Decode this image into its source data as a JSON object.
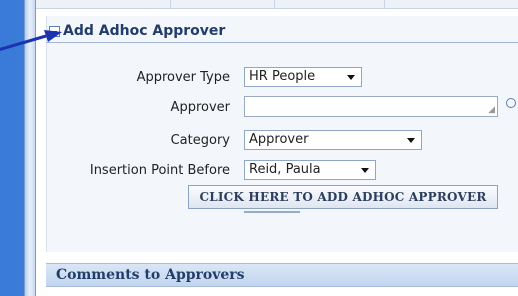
{
  "section": {
    "title": "Add Adhoc Approver"
  },
  "form": {
    "approver_type": {
      "label": "Approver Type",
      "value": "HR People"
    },
    "approver": {
      "label": "Approver",
      "value": ""
    },
    "category": {
      "label": "Category",
      "value": "Approver"
    },
    "insertion_point": {
      "label": "Insertion Point Before",
      "value": "Reid, Paula"
    },
    "add_button_label": "CLICK HERE TO ADD ADHOC APPROVER"
  },
  "comments": {
    "title": "Comments to Approvers"
  },
  "icons": {
    "collapse": "collapse-minus-icon",
    "search": "search-icon",
    "dropdown": "chevron-down-icon",
    "pointer": "annotation-arrow-icon"
  },
  "colors": {
    "desktop_blue": "#4a86d8",
    "section_title": "#233d6b",
    "header_bar": "#c2d5ee",
    "arrow": "#1a33b0"
  }
}
